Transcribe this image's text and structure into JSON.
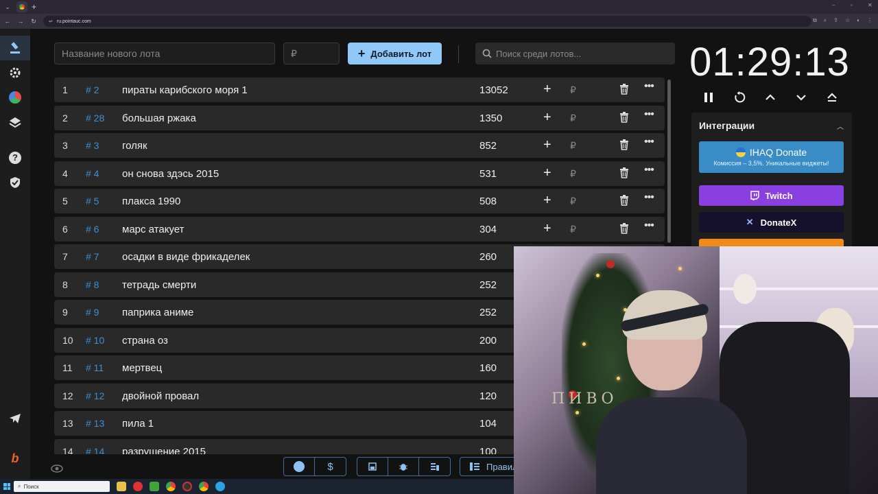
{
  "browser": {
    "url": "ru.pointauc.com"
  },
  "toolbar": {
    "new_lot_placeholder": "Название нового лота",
    "amount_placeholder": "₽",
    "add_lot_label": "Добавить лот",
    "search_placeholder": "Поиск среди лотов..."
  },
  "lots": [
    {
      "idx": "1",
      "fid": "# 2",
      "name": "пираты карибского моря 1",
      "amount": "13052"
    },
    {
      "idx": "2",
      "fid": "# 28",
      "name": "большая ржака",
      "amount": "1350"
    },
    {
      "idx": "3",
      "fid": "# 3",
      "name": "голяк",
      "amount": "852"
    },
    {
      "idx": "4",
      "fid": "# 4",
      "name": "он снова здэсь 2015",
      "amount": "531"
    },
    {
      "idx": "5",
      "fid": "# 5",
      "name": "плакса 1990",
      "amount": "508"
    },
    {
      "idx": "6",
      "fid": "# 6",
      "name": "марс атакует",
      "amount": "304"
    },
    {
      "idx": "7",
      "fid": "# 7",
      "name": "осадки в виде фрикаделек",
      "amount": "260"
    },
    {
      "idx": "8",
      "fid": "# 8",
      "name": "тетрадь смерти",
      "amount": "252"
    },
    {
      "idx": "9",
      "fid": "# 9",
      "name": "паприка аниме",
      "amount": "252"
    },
    {
      "idx": "10",
      "fid": "# 10",
      "name": "страна оз",
      "amount": "200"
    },
    {
      "idx": "11",
      "fid": "# 11",
      "name": "мертвец",
      "amount": "160"
    },
    {
      "idx": "12",
      "fid": "# 12",
      "name": " двойной провал",
      "amount": "120"
    },
    {
      "idx": "13",
      "fid": "# 13",
      "name": "пила 1",
      "amount": "104"
    },
    {
      "idx": "14",
      "fid": "# 14",
      "name": "разрушение 2015",
      "amount": "100"
    }
  ],
  "row_actions": {
    "currency": "₽"
  },
  "bottom": {
    "rules_label": "Правил"
  },
  "timer": {
    "value": "01:29:13"
  },
  "integrations": {
    "title": "Интеграции",
    "ihaq_title": "IHAQ Donate",
    "ihaq_subtitle": "Комиссия – 3,5%. Уникальные виджеты!",
    "twitch": "Twitch",
    "donatex": "DonateX"
  },
  "webcam": {
    "shirt_text": "ПИВО"
  },
  "taskbar": {
    "search_label": "Поиск"
  },
  "colors": {
    "accent": "#90c8f8",
    "lot_id": "#3d8fd6",
    "twitch": "#8a3fe0",
    "ihaq": "#3a8cc6"
  }
}
